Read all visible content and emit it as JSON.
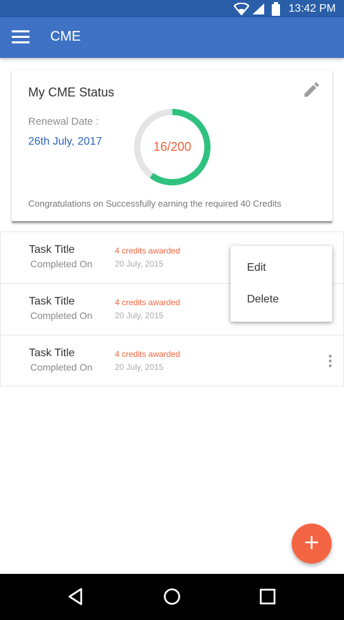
{
  "status_bar": {
    "time": "13:42 PM",
    "icons": [
      "wifi-icon",
      "signal-icon",
      "battery-icon"
    ]
  },
  "app_bar": {
    "title": "CME",
    "menu_icon": "hamburger-menu-icon"
  },
  "status_card": {
    "title": "My CME Status",
    "edit_icon": "pencil-icon",
    "renewal_label": "Renewal Date :",
    "renewal_date": "26th July, 2017",
    "progress": {
      "earned": 16,
      "total": 200,
      "label": "16/200",
      "fraction_shown": 0.6
    },
    "message": "Congratulations on Successfully earning the required 40 Credits"
  },
  "tasks": [
    {
      "title": "Task Title",
      "completed_label": "Completed On",
      "credits": "4 credits awarded",
      "date": "20 July, 2015"
    },
    {
      "title": "Task Title",
      "completed_label": "Completed On",
      "credits": "4 credits awarded",
      "date": "20 July, 2015"
    },
    {
      "title": "Task Title",
      "completed_label": "Completed On",
      "credits": "4 credits awarded",
      "date": "20 July, 2015"
    }
  ],
  "popup_menu": {
    "items": [
      {
        "label": "Edit"
      },
      {
        "label": "Delete"
      }
    ]
  },
  "fab": {
    "label": "+",
    "icon": "add-icon"
  },
  "nav_bar": {
    "buttons": [
      "back-icon",
      "home-icon",
      "recents-icon"
    ]
  },
  "colors": {
    "status_bar": "#2a5ea8",
    "app_bar": "#3f72c4",
    "accent": "#f36442",
    "progress_ring": "#2ec27e",
    "progress_track": "#e4e4e4",
    "link_blue": "#2e64b8"
  }
}
